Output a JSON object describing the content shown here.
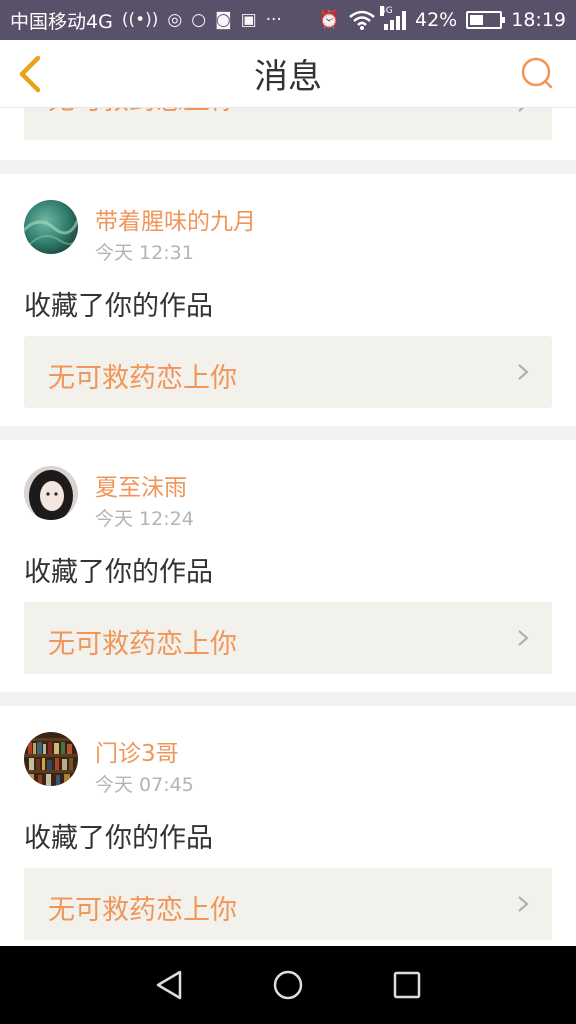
{
  "status_bar": {
    "carrier": "中国移动4G",
    "battery": "42%",
    "time": "18:19",
    "network_tag": "4G",
    "battery_level": 0.42,
    "icons": [
      "hotspot-icon",
      "location-icon",
      "message-icon",
      "wifi-tool-icon",
      "image-icon",
      "more-icon",
      "alarm-icon",
      "wifi-icon",
      "signal-icon",
      "battery-icon"
    ]
  },
  "header": {
    "title": "消息",
    "back_icon": "chevron-left-icon",
    "search_icon": "search-icon",
    "accent": "#f0965a"
  },
  "partial_item": {
    "work_title": "无可救药恋上你"
  },
  "messages": [
    {
      "user": "带着腥味的九月",
      "time": "今天 12:31",
      "action": "收藏了你的作品",
      "work_title": "无可救药恋上你"
    },
    {
      "user": "夏至沫雨",
      "time": "今天 12:24",
      "action": "收藏了你的作品",
      "work_title": "无可救药恋上你"
    },
    {
      "user": "门诊3哥",
      "time": "今天 07:45",
      "action": "收藏了你的作品",
      "work_title": "无可救药恋上你"
    }
  ],
  "nav_bar": {
    "icons": [
      "back-triangle-icon",
      "home-circle-icon",
      "recents-square-icon"
    ]
  }
}
